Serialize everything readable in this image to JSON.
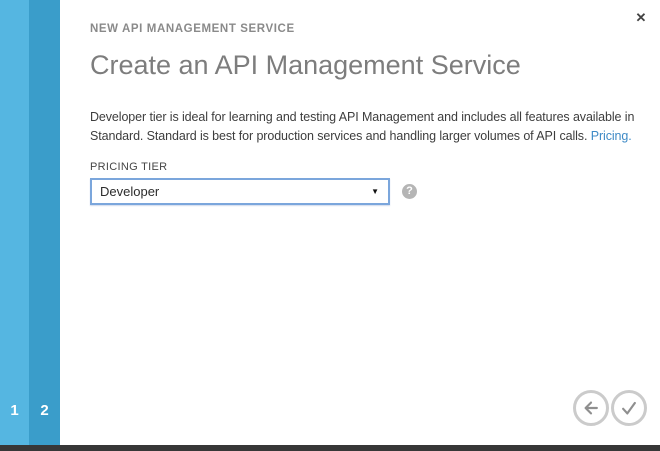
{
  "window": {
    "close_icon": "✕"
  },
  "panel": {
    "eyebrow": "NEW API MANAGEMENT SERVICE",
    "title": "Create an API Management Service",
    "description": "Developer tier is ideal for learning and testing API Management and includes all features available in Standard. Standard is best for production services and handling larger volumes of API calls.",
    "pricing_link": "Pricing."
  },
  "form": {
    "pricing_tier": {
      "label": "PRICING TIER",
      "selected_option": "Developer",
      "dropdown_arrow": "▼",
      "help_icon_glyph": "?"
    }
  },
  "steps": {
    "current": "2",
    "items": [
      {
        "number": "1"
      },
      {
        "number": "2"
      }
    ]
  },
  "footer": {
    "back_icon": "arrow-left",
    "confirm_icon": "checkmark"
  },
  "colors": {
    "step1_bar": "#55b6e1",
    "step2_bar": "#3a9dca",
    "select_border": "#7ba6dc",
    "link": "#3e8ac6",
    "bottom_strip": "#373737",
    "title_text": "#7d7d7d",
    "body_text": "#3d3d3d",
    "nav_circle_border": "#cbcbcb",
    "nav_icon": "#8f8f8f"
  }
}
